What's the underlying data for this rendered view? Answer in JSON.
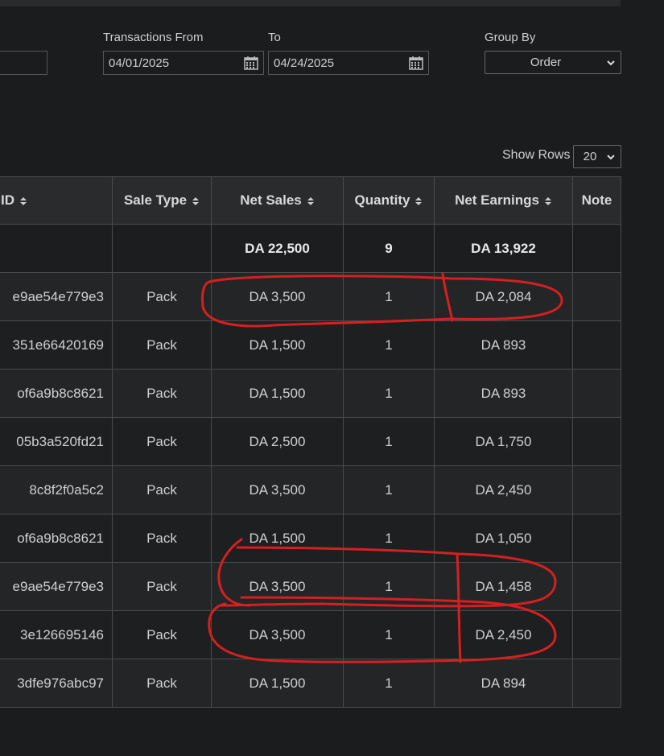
{
  "filters": {
    "from_label": "Transactions From",
    "from_value": "04/01/2025",
    "to_label": "To",
    "to_value": "04/24/2025",
    "group_label": "Group By",
    "group_value": "Order"
  },
  "show_rows": {
    "label": "Show Rows",
    "value": "20"
  },
  "table": {
    "headers": [
      "ID",
      "Sale Type",
      "Net Sales",
      "Quantity",
      "Net Earnings",
      "Note"
    ],
    "totals": {
      "net_sales": "DA 22,500",
      "quantity": "9",
      "net_earnings": "DA 13,922"
    },
    "rows": [
      {
        "id": "e9ae54e779e3",
        "sale_type": "Pack",
        "net_sales": "DA 3,500",
        "quantity": "1",
        "net_earnings": "DA 2,084"
      },
      {
        "id": "351e66420169",
        "sale_type": "Pack",
        "net_sales": "DA 1,500",
        "quantity": "1",
        "net_earnings": "DA 893"
      },
      {
        "id": "of6a9b8c8621",
        "sale_type": "Pack",
        "net_sales": "DA 1,500",
        "quantity": "1",
        "net_earnings": "DA 893"
      },
      {
        "id": "05b3a520fd21",
        "sale_type": "Pack",
        "net_sales": "DA 2,500",
        "quantity": "1",
        "net_earnings": "DA 1,750"
      },
      {
        "id": "8c8f2f0a5c2",
        "sale_type": "Pack",
        "net_sales": "DA 3,500",
        "quantity": "1",
        "net_earnings": "DA 2,450"
      },
      {
        "id": "of6a9b8c8621",
        "sale_type": "Pack",
        "net_sales": "DA 1,500",
        "quantity": "1",
        "net_earnings": "DA 1,050"
      },
      {
        "id": "e9ae54e779e3",
        "sale_type": "Pack",
        "net_sales": "DA 3,500",
        "quantity": "1",
        "net_earnings": "DA 1,458"
      },
      {
        "id": "3e126695146",
        "sale_type": "Pack",
        "net_sales": "DA 3,500",
        "quantity": "1",
        "net_earnings": "DA 2,450"
      },
      {
        "id": "3dfe976abc97",
        "sale_type": "Pack",
        "net_sales": "DA 1,500",
        "quantity": "1",
        "net_earnings": "DA 894"
      }
    ]
  },
  "icons": {
    "calendar": "calendar-icon",
    "sort": "sort-icon",
    "dropdown": "chevron-down-icon"
  },
  "colors": {
    "background": "#1b1c1e",
    "header_bg": "#2a2b2d",
    "row_alt": "#242527",
    "annotation": "#d42020"
  }
}
